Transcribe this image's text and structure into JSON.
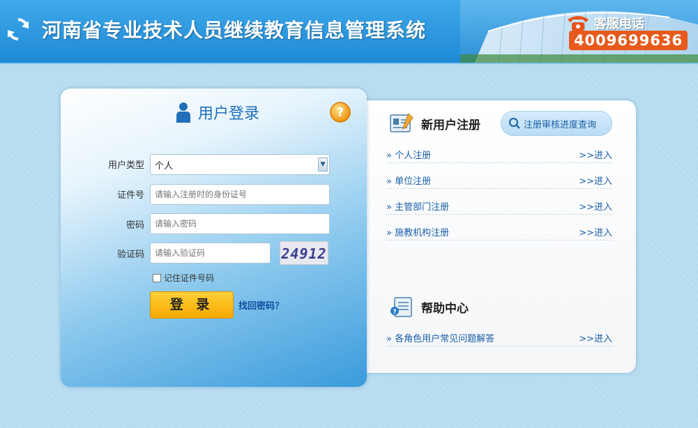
{
  "header": {
    "title": "河南省专业技术人员继续教育信息管理系统",
    "hotline_label": "客服电话",
    "hotline_number": "4009699636"
  },
  "login": {
    "title": "用户登录",
    "user_type_label": "用户类型",
    "user_type_value": "个人",
    "id_label": "证件号",
    "id_placeholder": "请输入注册时的身份证号",
    "password_label": "密码",
    "password_placeholder": "请输入密码",
    "captcha_label": "验证码",
    "captcha_placeholder": "请输入验证码",
    "captcha_value": "24912",
    "remember_label": "记住证件号码",
    "login_button": "登 录",
    "forgot_link": "找回密码？"
  },
  "registration": {
    "title": "新用户注册",
    "progress_button": "注册审核进度查询",
    "items": [
      {
        "label": "» 个人注册",
        "action": ">>进入"
      },
      {
        "label": "» 单位注册",
        "action": ">>进入"
      },
      {
        "label": "» 主管部门注册",
        "action": ">>进入"
      },
      {
        "label": "» 施教机构注册",
        "action": ">>进入"
      }
    ]
  },
  "help": {
    "title": "帮助中心",
    "items": [
      {
        "label": "» 各角色用户常见问题解答",
        "action": ">>进入"
      }
    ]
  },
  "colors": {
    "header_blue": "#2a96de",
    "login_button": "#f6a800",
    "hotline_badge": "#e85a1b",
    "link_blue": "#1a5fa6"
  }
}
